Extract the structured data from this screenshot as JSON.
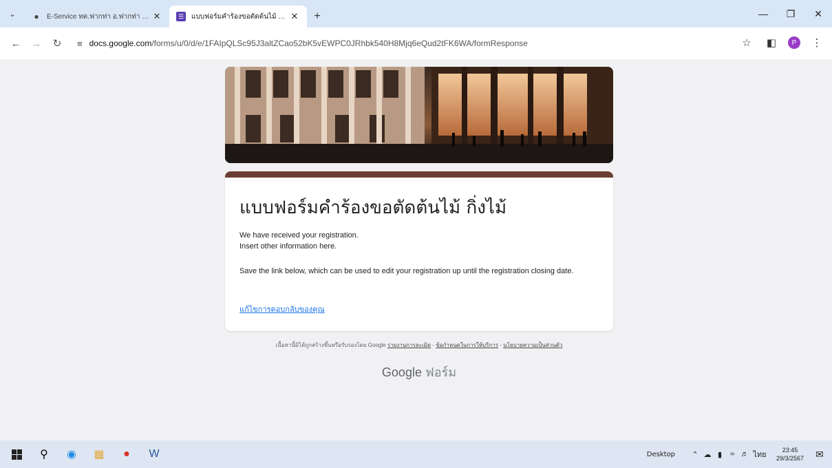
{
  "browser": {
    "tabs": [
      {
        "title": "E-Service ทต.ฟากท่า อ.ฟากท่า จ.อุ",
        "active": false,
        "icon": "globe-icon"
      },
      {
        "title": "แบบฟอร์มคำร้องขอตัดต้นไม้ กิ่งไม้",
        "active": true,
        "icon": "google-forms-icon"
      }
    ],
    "url_host": "docs.google.com",
    "url_path": "/forms/u/0/d/e/1FAIpQLSc95J3altZCao52bK5vEWPC0JRhbk540H8Mjq6eQud2tFK6WA/formResponse",
    "profile_initial": "P"
  },
  "form": {
    "title": "แบบฟอร์มคำร้องขอตัดต้นไม้ กิ่งไม้",
    "message_line1": "We have received your registration.",
    "message_line2": "Insert other information here.",
    "message_line3": "Save the link below, which can be used to edit your registration up until the registration closing date.",
    "edit_link": "แก้ไขการตอบกลับของคุณ",
    "accent_color": "#6b3e33"
  },
  "footer": {
    "note": "เนื้อหานี้มิได้ถูกสร้างขึ้นหรือรับรองโดย Google",
    "link_report": "รายงานการละเมิด",
    "link_terms": "ข้อกำหนดในการให้บริการ",
    "link_privacy": "นโยบายความเป็นส่วนตัว",
    "brand_google": "Google",
    "brand_forms": "ฟอร์ม"
  },
  "taskbar": {
    "desktop_label": "Desktop",
    "lang": "ไทย",
    "time": "23:45",
    "date": "29/3/2567"
  }
}
